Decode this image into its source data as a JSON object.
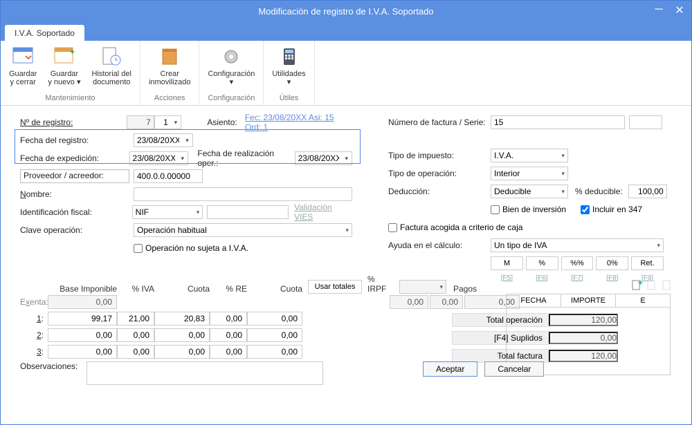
{
  "window": {
    "title": "Modificación de registro de I.V.A. Soportado"
  },
  "tab": {
    "label": "I.V.A. Soportado"
  },
  "ribbon": {
    "mantenimiento": {
      "group": "Mantenimiento",
      "guardar_cerrar": "Guardar\ny cerrar",
      "guardar_nuevo": "Guardar\ny nuevo ▾",
      "historial": "Historial del\ndocumento"
    },
    "acciones": {
      "group": "Acciones",
      "crear": "Crear\ninmovilizado"
    },
    "configuracion": {
      "group": "Configuración",
      "conf": "Configuración\n▾"
    },
    "utiles": {
      "group": "Útiles",
      "util": "Utilidades\n▾"
    }
  },
  "form": {
    "nregistro_lbl": "Nº de registro:",
    "nregistro": "7",
    "nregistro_ord": "1",
    "asiento_lbl": "Asiento:",
    "asiento_link": "Fec: 23/08/20XX Asi: 15 Ord: 1",
    "fecha_registro_lbl": "Fecha del registro:",
    "fecha_registro": "23/08/20XX",
    "fecha_exp_lbl": "Fecha de expedición:",
    "fecha_exp": "23/08/20XX",
    "fecha_oper_lbl": "Fecha de realización oper.:",
    "fecha_oper": "23/08/20XX",
    "proveedor_lbl": "Proveedor / acreedor:",
    "proveedor": "400.0.0.00000",
    "nombre_lbl": "Nombre:",
    "nombre": "",
    "idfiscal_lbl": "Identificación fiscal:",
    "idfiscal_tipo": "NIF",
    "idfiscal_num": "",
    "validacion": "Validación VIES",
    "clave_lbl": "Clave operación:",
    "clave": "Operación habitual",
    "op_no_sujeta": "Operación no sujeta a I.V.A.",
    "nfactura_lbl": "Número de factura / Serie:",
    "nfactura": "15",
    "serie": "",
    "tipo_imp_lbl": "Tipo de impuesto:",
    "tipo_imp": "I.V.A.",
    "tipo_op_lbl": "Tipo de operación:",
    "tipo_op": "Interior",
    "deduccion_lbl": "Deducción:",
    "deduccion": "Deducible",
    "pct_ded_lbl": "% deducible:",
    "pct_ded": "100,00",
    "bien_inv": "Bien de inversión",
    "incluir_347": "Incluir en 347",
    "criterio_caja": "Factura acogida a criterio de caja",
    "ayuda_lbl": "Ayuda en el cálculo:",
    "ayuda": "Un tipo de IVA",
    "mini": {
      "m": "M",
      "pct": "%",
      "pctpct": "%%",
      "zpct": "0%",
      "ret": "Ret."
    },
    "fkeys": {
      "f5": "[F5]",
      "f6": "[F6]",
      "f7": "[F7]",
      "f8": "[F8]",
      "f9": "[F9]"
    }
  },
  "grid": {
    "headers": {
      "base": "Base Imponible",
      "piva": "% IVA",
      "cuota": "Cuota",
      "pre": "% RE",
      "cuota2": "Cuota",
      "usar_totales": "Usar totales",
      "pirpf": "% IRPF",
      "pagos": "Pagos"
    },
    "exenta_lbl": "Exenta:",
    "exenta": "0,00",
    "rows": [
      {
        "n": "1:",
        "base": "99,17",
        "piva": "21,00",
        "cuota": "20,83",
        "pre": "0,00",
        "cuota2": "0,00"
      },
      {
        "n": "2:",
        "base": "0,00",
        "piva": "0,00",
        "cuota": "0,00",
        "pre": "0,00",
        "cuota2": "0,00"
      },
      {
        "n": "3:",
        "base": "0,00",
        "piva": "0,00",
        "cuota": "0,00",
        "pre": "0,00",
        "cuota2": "0,00"
      }
    ],
    "irpf_pct": "",
    "irpf_v1": "0,00",
    "irpf_v2": "0,00",
    "irpf_v3": "0,00"
  },
  "totals": {
    "total_op_lbl": "Total operación",
    "total_op": "120,00",
    "suplidos_lbl": "[F4] Suplidos",
    "suplidos": "0,00",
    "total_fac_lbl": "Total factura",
    "total_fac": "120,00"
  },
  "pagos": {
    "fecha": "FECHA",
    "importe": "IMPORTE",
    "e": "E"
  },
  "obs_lbl": "Observaciones:",
  "obs": "",
  "buttons": {
    "aceptar": "Aceptar",
    "cancelar": "Cancelar"
  }
}
